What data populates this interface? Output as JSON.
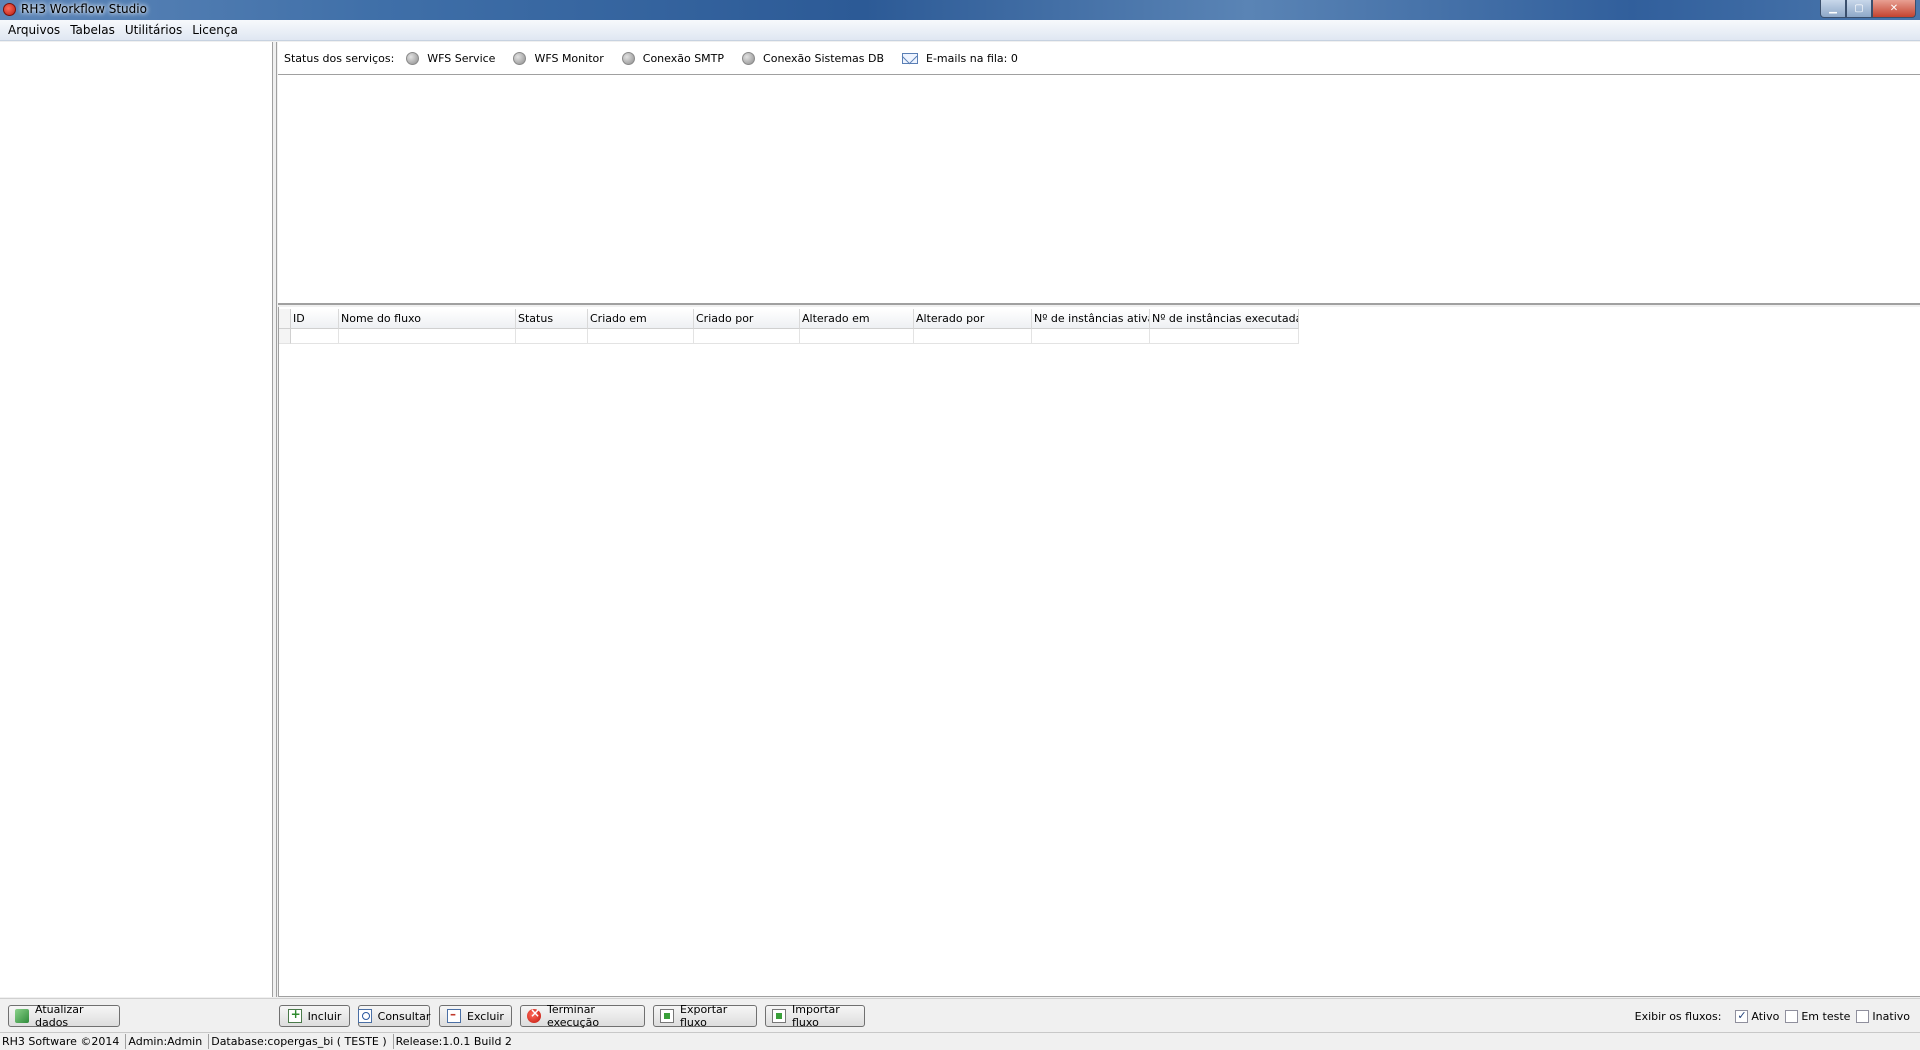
{
  "window": {
    "title": "RH3 Workflow Studio",
    "controls": {
      "minimize": "▁",
      "maximize": "▢",
      "close": "✕"
    }
  },
  "menu": [
    "Arquivos",
    "Tabelas",
    "Utilitários",
    "Licença"
  ],
  "services": {
    "label": "Status dos serviços:",
    "items": [
      "WFS Service",
      "WFS Monitor",
      "Conexão SMTP",
      "Conexão Sistemas DB"
    ],
    "emails": "E-mails na fila: 0"
  },
  "grid": {
    "columns": [
      "ID",
      "Nome do fluxo",
      "Status",
      "Criado em",
      "Criado por",
      "Alterado em",
      "Alterado por",
      "Nº de instâncias ativas",
      "Nº de instâncias executadas"
    ],
    "rows": []
  },
  "toolbar": {
    "refresh": "Atualizar dados",
    "add": "Incluir",
    "view": "Consultar",
    "delete": "Excluir",
    "terminate": "Terminar execução",
    "export": "Exportar fluxo",
    "import": "Importar fluxo"
  },
  "filters": {
    "label": "Exibir os fluxos:",
    "active": {
      "label": "Ativo",
      "checked": true
    },
    "testing": {
      "label": "Em teste",
      "checked": false
    },
    "inactive": {
      "label": "Inativo",
      "checked": false
    }
  },
  "statusbar": {
    "copyright": "RH3 Software ©2014",
    "user": "Admin:Admin",
    "database": "Database:copergas_bi ( TESTE )",
    "release": "Release:1.0.1 Build 2"
  },
  "colors": {
    "titlebar": "#3f6fa8",
    "led_off": "#8d8d8d",
    "close_button": "#c4432f"
  }
}
